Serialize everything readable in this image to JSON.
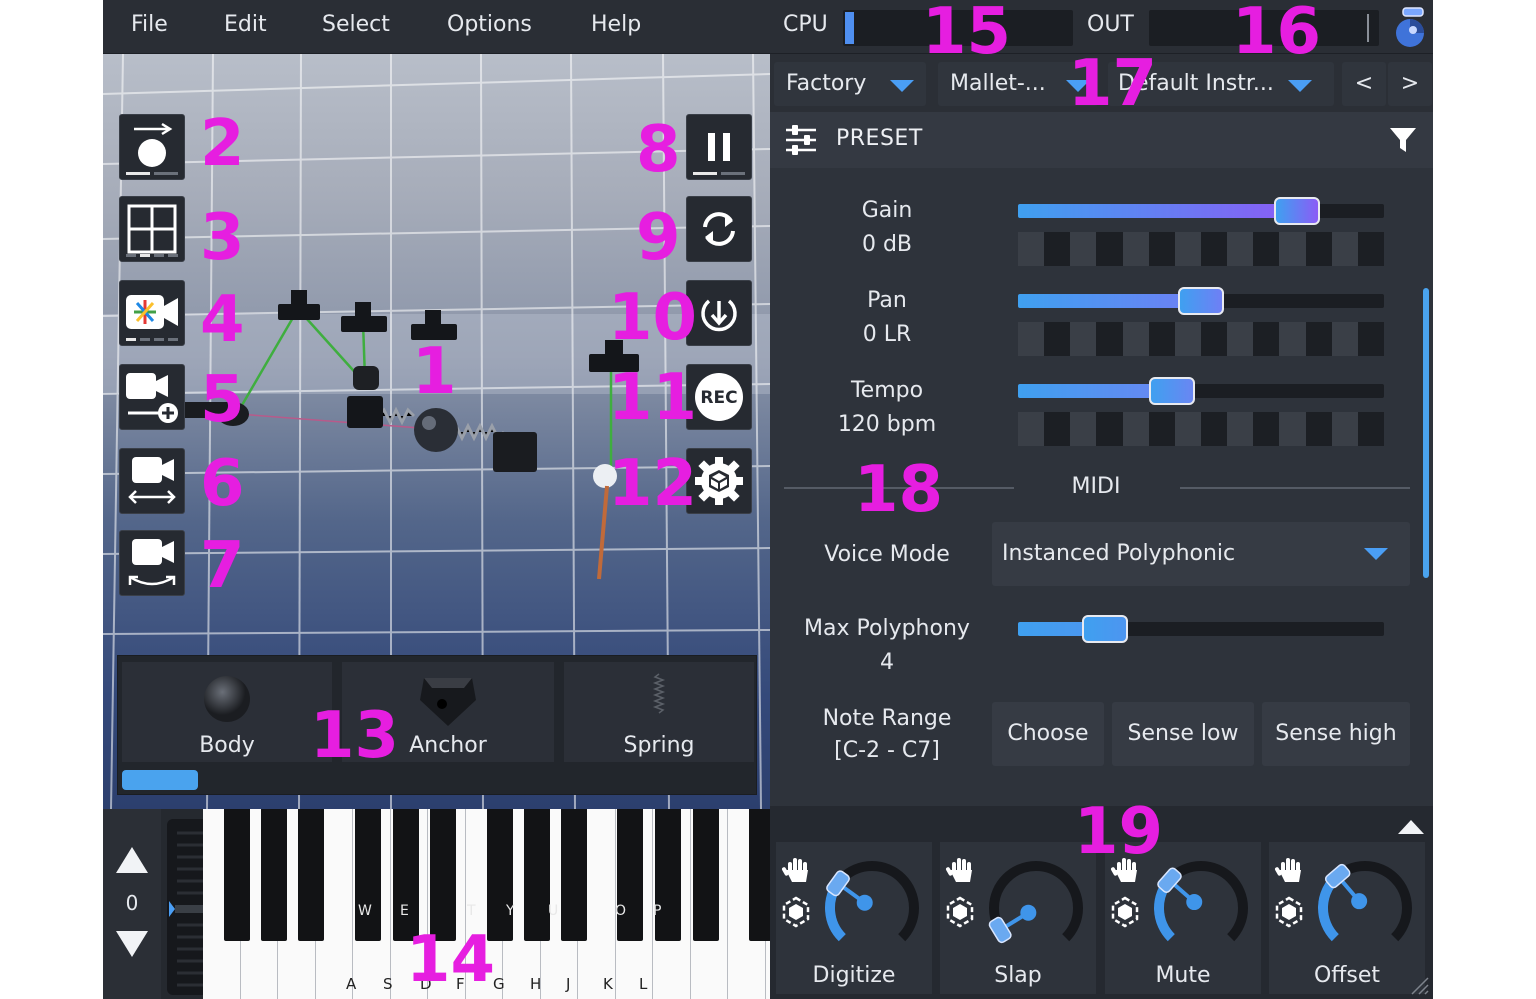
{
  "menu": {
    "file": "File",
    "edit": "Edit",
    "select": "Select",
    "options": "Options",
    "help": "Help"
  },
  "meters": {
    "cpu_label": "CPU",
    "cpu_level": 0.04,
    "out_label": "OUT"
  },
  "presets": {
    "bank": "Factory",
    "category": "Mallet-...",
    "instrument": "Default Instr...",
    "prev": "<",
    "next": ">"
  },
  "preset_panel": {
    "title": "PRESET"
  },
  "params": {
    "gain": {
      "label": "Gain",
      "value": "0 dB",
      "level": 0.8
    },
    "pan": {
      "label": "Pan",
      "value": "0 LR",
      "level": 0.5
    },
    "tempo": {
      "label": "Tempo",
      "value": "120 bpm",
      "level": 0.41
    }
  },
  "midi": {
    "section": "MIDI",
    "voice_mode_label": "Voice Mode",
    "voice_mode_value": "Instanced Polyphonic",
    "max_poly_label": "Max Polyphony",
    "max_poly_value": "4",
    "max_poly_level": 0.2,
    "note_range_label": "Note Range",
    "note_range_value": "[C-2 - C7]",
    "choose": "Choose",
    "sense_low": "Sense low",
    "sense_high": "Sense high"
  },
  "knobs": [
    {
      "label": "Digitize",
      "level": 0.3
    },
    {
      "label": "Slap",
      "level": 0.05
    },
    {
      "label": "Mute",
      "level": 0.32
    },
    {
      "label": "Offset",
      "level": 0.35
    }
  ],
  "palette": {
    "body": "Body",
    "anchor": "Anchor",
    "spring": "Spring"
  },
  "keyboard": {
    "octave": "0",
    "white_labels": [
      "A",
      "S",
      "D",
      "F",
      "G",
      "H",
      "J",
      "K",
      "L"
    ],
    "black_labels": [
      "W",
      "E",
      "T",
      "Y",
      "U",
      "O",
      "P"
    ]
  },
  "callouts": [
    "1",
    "2",
    "3",
    "4",
    "5",
    "6",
    "7",
    "8",
    "9",
    "10",
    "11",
    "12",
    "13",
    "14",
    "15",
    "16",
    "17",
    "18",
    "19"
  ],
  "colors": {
    "accent": "#4a9ef5",
    "callout": "#e61ee0",
    "slider_end": "#8b5cf6"
  },
  "icons": {
    "rec_button": "REC"
  }
}
